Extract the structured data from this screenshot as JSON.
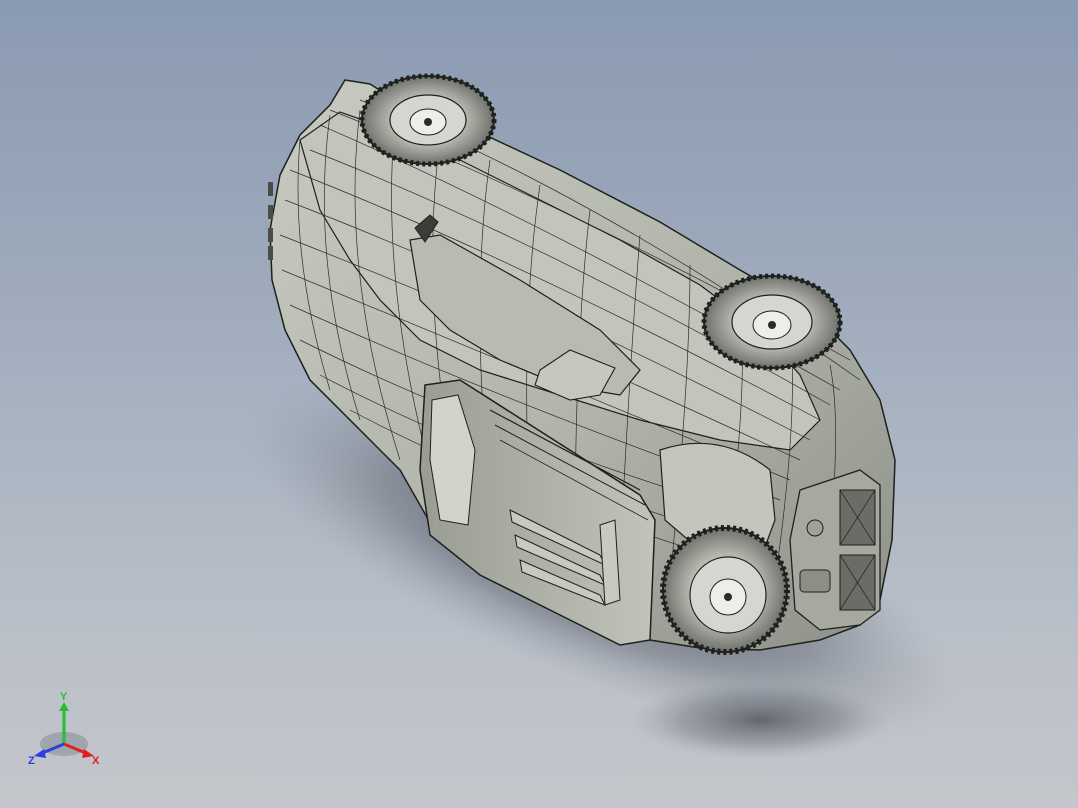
{
  "viewport": {
    "background_top": "#8a9ab1",
    "background_bottom": "#c4c6cb",
    "model_color": "#b4b7ad",
    "edge_color": "#1e201d"
  },
  "triad": {
    "x_label": "X",
    "y_label": "Y",
    "z_label": "Z",
    "x_color": "#e0201c",
    "y_color": "#22c22a",
    "z_color": "#2c3fe0"
  }
}
